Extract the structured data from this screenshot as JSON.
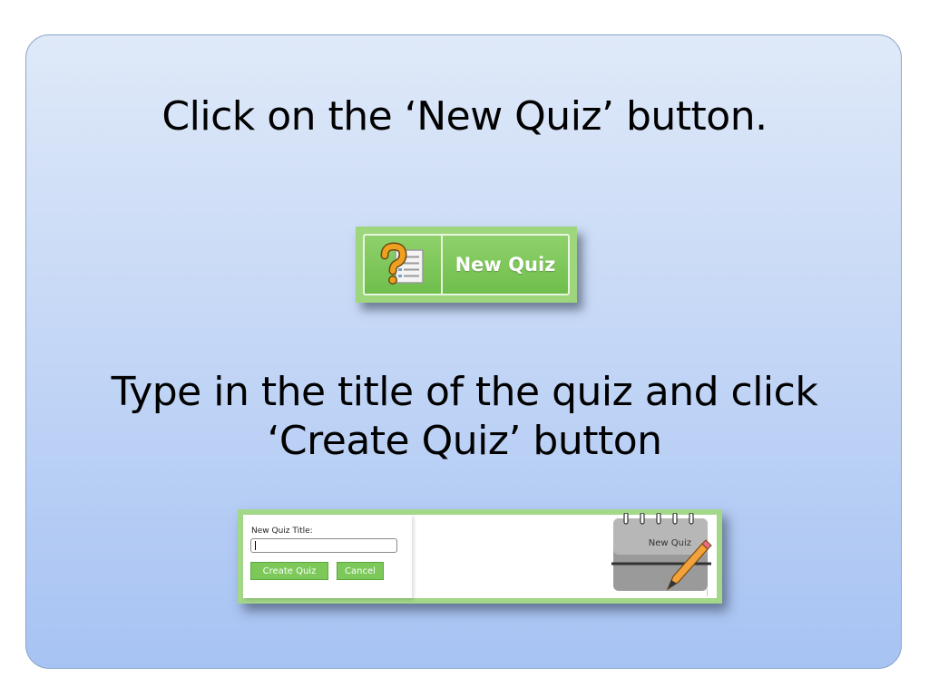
{
  "slide": {
    "heading_1": "Click on the ‘New Quiz’ button.",
    "heading_2": "Type in the title of the quiz and click",
    "heading_3": "‘Create Quiz’ button"
  },
  "new_quiz_button": {
    "label": "New Quiz",
    "icon": "question-document-icon"
  },
  "create_form": {
    "title_label": "New Quiz Title:",
    "title_value": "",
    "create_label": "Create Quiz",
    "cancel_label": "Cancel",
    "notebook_label": "New Quiz",
    "notebook_icon": "notebook-pencil-icon"
  },
  "colors": {
    "button_green": "#7cc95a",
    "panel_top": "#dfe9f8",
    "panel_bottom": "#a7c3f3"
  }
}
